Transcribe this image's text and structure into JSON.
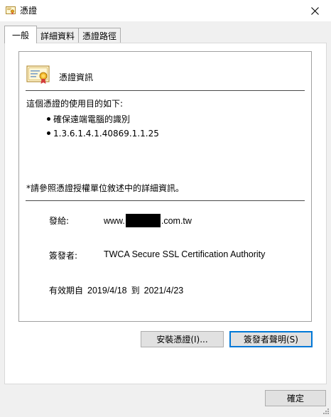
{
  "window": {
    "title": "憑證",
    "icon": "certificate-icon",
    "close_icon": "close-icon"
  },
  "tabs": [
    {
      "label": "一般",
      "active": true
    },
    {
      "label": "詳細資料",
      "active": false
    },
    {
      "label": "憑證路徑",
      "active": false
    }
  ],
  "info": {
    "heading": "憑證資訊",
    "purpose_title": "這個憑證的使用目的如下:",
    "purposes": [
      "確保遠端電腦的識別",
      "1.3.6.1.4.1.40869.1.1.25"
    ],
    "note": "*請參照憑證授權單位敘述中的詳細資訊。",
    "issued_to_label": "發給:",
    "issued_to_prefix": "www.",
    "issued_to_suffix": ".com.tw",
    "issued_by_label": "簽發者:",
    "issued_by_value": "TWCA Secure SSL Certification Authority",
    "validity_label": "有效期自",
    "valid_from": "2019/4/18",
    "validity_to": "到",
    "valid_to": "2021/4/23"
  },
  "buttons": {
    "install": "安裝憑證(I)...",
    "issuer_statement": "簽發者聲明(S)",
    "ok": "確定"
  },
  "colors": {
    "accent": "#0078d7",
    "window_bg": "#f0f0f0",
    "panel_bg": "#ffffff"
  }
}
